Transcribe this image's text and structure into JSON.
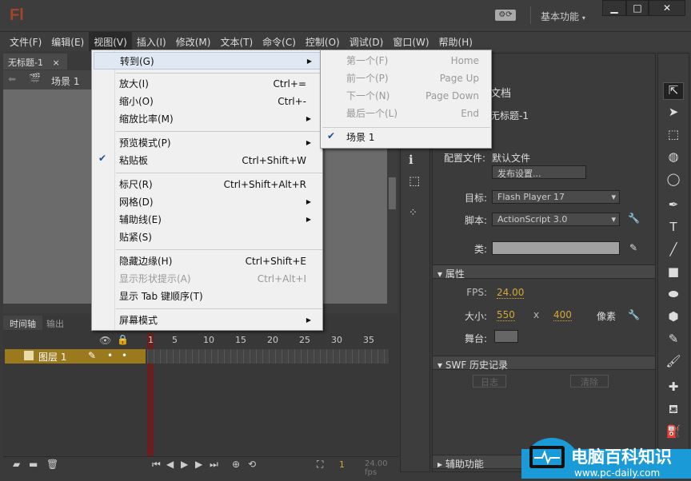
{
  "app": {
    "logo": "Fl",
    "workspace": "基本功能",
    "sync_icon": "gear-sync-icon"
  },
  "window_controls": {
    "minimize": "▁",
    "maximize": "□",
    "close": "✕"
  },
  "menubar": [
    "文件(F)",
    "编辑(E)",
    "视图(V)",
    "插入(I)",
    "修改(M)",
    "文本(T)",
    "命令(C)",
    "控制(O)",
    "调试(D)",
    "窗口(W)",
    "帮助(H)"
  ],
  "document": {
    "tab": "无标题-1",
    "tab_close": "×",
    "scene": "场景 1"
  },
  "view_menu": {
    "items": [
      {
        "label": "转到(G)",
        "submenu": true
      },
      {
        "label": "放大(I)",
        "shortcut": "Ctrl+="
      },
      {
        "label": "缩小(O)",
        "shortcut": "Ctrl+-"
      },
      {
        "label": "缩放比率(M)",
        "submenu": true
      },
      {
        "label": "预览模式(P)",
        "submenu": true
      },
      {
        "label": "粘贴板",
        "shortcut": "Ctrl+Shift+W",
        "checked": true
      },
      {
        "label": "标尺(R)",
        "shortcut": "Ctrl+Shift+Alt+R"
      },
      {
        "label": "网格(D)",
        "submenu": true
      },
      {
        "label": "辅助线(E)",
        "submenu": true
      },
      {
        "label": "贴紧(S)"
      },
      {
        "label": "隐藏边缘(H)",
        "shortcut": "Ctrl+Shift+E"
      },
      {
        "label": "显示形状提示(A)",
        "shortcut": "Ctrl+Alt+I",
        "disabled": true
      },
      {
        "label": "显示 Tab 键顺序(T)"
      },
      {
        "label": "屏幕模式",
        "submenu": true
      }
    ]
  },
  "goto_submenu": [
    {
      "label": "第一个(F)",
      "shortcut": "Home",
      "disabled": true
    },
    {
      "label": "前一个(P)",
      "shortcut": "Page Up",
      "disabled": true
    },
    {
      "label": "下一个(N)",
      "shortcut": "Page Down",
      "disabled": true
    },
    {
      "label": "最后一个(L)",
      "shortcut": "End",
      "disabled": true
    },
    {
      "label": "场景 1",
      "checked": true
    }
  ],
  "timeline": {
    "tabs": [
      "时间轴",
      "输出"
    ],
    "layer": "图层 1",
    "ruler": [
      "1",
      "5",
      "10",
      "15",
      "20",
      "25",
      "30",
      "35"
    ],
    "current_frame": "1",
    "fps": "24.00 fps"
  },
  "properties": {
    "doc_type": "文档",
    "doc_name": "无标题-1",
    "profile_label": "配置文件:",
    "profile_value": "默认文件",
    "publish_button": "发布设置...",
    "target_label": "目标:",
    "target_value": "Flash Player 17",
    "script_label": "脚本:",
    "script_value": "ActionScript 3.0",
    "class_label": "类:",
    "section_props": "属性",
    "fps_label": "FPS:",
    "fps_value": "24.00",
    "size_label": "大小:",
    "width": "550",
    "x": "x",
    "height": "400",
    "unit": "像素",
    "stage_label": "舞台:",
    "stage_color": "#666666",
    "section_swf": "SWF 历史记录",
    "log_button": "日志",
    "clear_button": "清除",
    "section_access": "辅助功能"
  },
  "watermark": {
    "title": "电脑百科知识",
    "url": "www.pc-daily.com"
  },
  "colors": {
    "accent_layer": "#9a7a1c",
    "playhead": "#6a1f1f",
    "number": "#d4a838"
  }
}
